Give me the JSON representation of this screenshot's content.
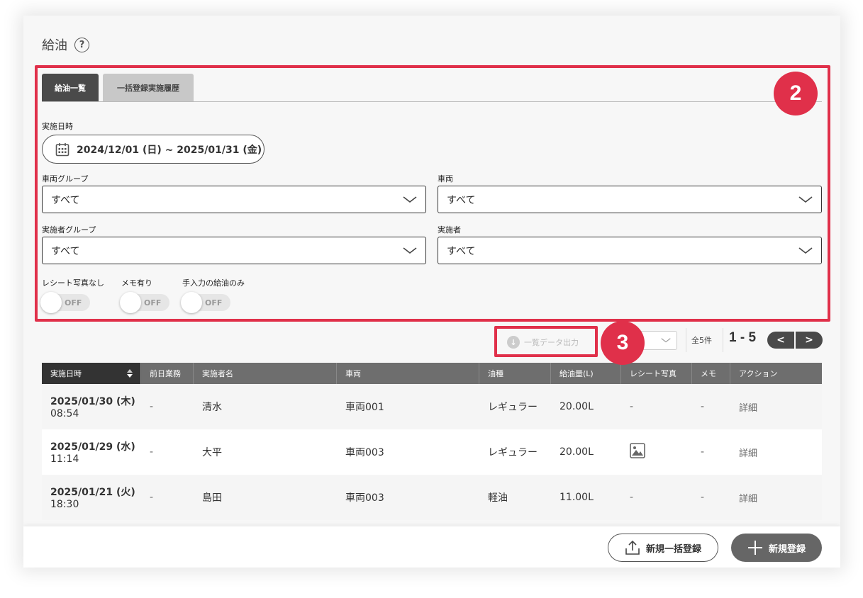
{
  "page": {
    "title": "給油",
    "help_symbol": "?"
  },
  "tabs": [
    {
      "label": "給油一覧",
      "active": true
    },
    {
      "label": "一括登録実施履歴",
      "active": false
    }
  ],
  "filters": {
    "date_label": "実施日時",
    "date_range": "2024/12/01 (日) ~ 2025/01/31 (金)",
    "vehicle_group": {
      "label": "車両グループ",
      "value": "すべて"
    },
    "vehicle": {
      "label": "車両",
      "value": "すべて"
    },
    "operator_group": {
      "label": "実施者グループ",
      "value": "すべて"
    },
    "operator": {
      "label": "実施者",
      "value": "すべて"
    },
    "toggles": [
      {
        "label": "レシート写真なし",
        "state": "OFF"
      },
      {
        "label": "メモ有り",
        "state": "OFF"
      },
      {
        "label": "手入力の給油のみ",
        "state": "OFF"
      }
    ]
  },
  "toolbar": {
    "export_label": "一覧データ出力",
    "total": "全5件",
    "range": "1 - 5",
    "prev": "<",
    "next": ">"
  },
  "table": {
    "headers": [
      "実施日時",
      "前日業務",
      "実施者名",
      "車両",
      "油種",
      "給油量(L)",
      "レシート写真",
      "メモ",
      "アクション"
    ],
    "rows": [
      {
        "date": "2025/01/30 (木)",
        "time": "08:54",
        "prev": "-",
        "operator": "清水",
        "vehicle": "車両001",
        "fuel": "レギュラー",
        "amount": "20.00L",
        "receipt": "-",
        "memo": "-",
        "action": "詳細"
      },
      {
        "date": "2025/01/29 (水)",
        "time": "11:14",
        "prev": "-",
        "operator": "大平",
        "vehicle": "車両003",
        "fuel": "レギュラー",
        "amount": "20.00L",
        "receipt": "image-icon",
        "memo": "-",
        "action": "詳細"
      },
      {
        "date": "2025/01/21 (火)",
        "time": "18:30",
        "prev": "-",
        "operator": "島田",
        "vehicle": "車両003",
        "fuel": "軽油",
        "amount": "11.00L",
        "receipt": "-",
        "memo": "-",
        "action": "詳細"
      }
    ]
  },
  "footer": {
    "bulk_register": "新規一括登録",
    "register": "新規登録"
  },
  "annotations": {
    "badge_2": "2",
    "badge_3": "3"
  },
  "colors": {
    "highlight": "#e0304a",
    "dark": "#4a4a4a",
    "header": "#6e6e6e"
  }
}
